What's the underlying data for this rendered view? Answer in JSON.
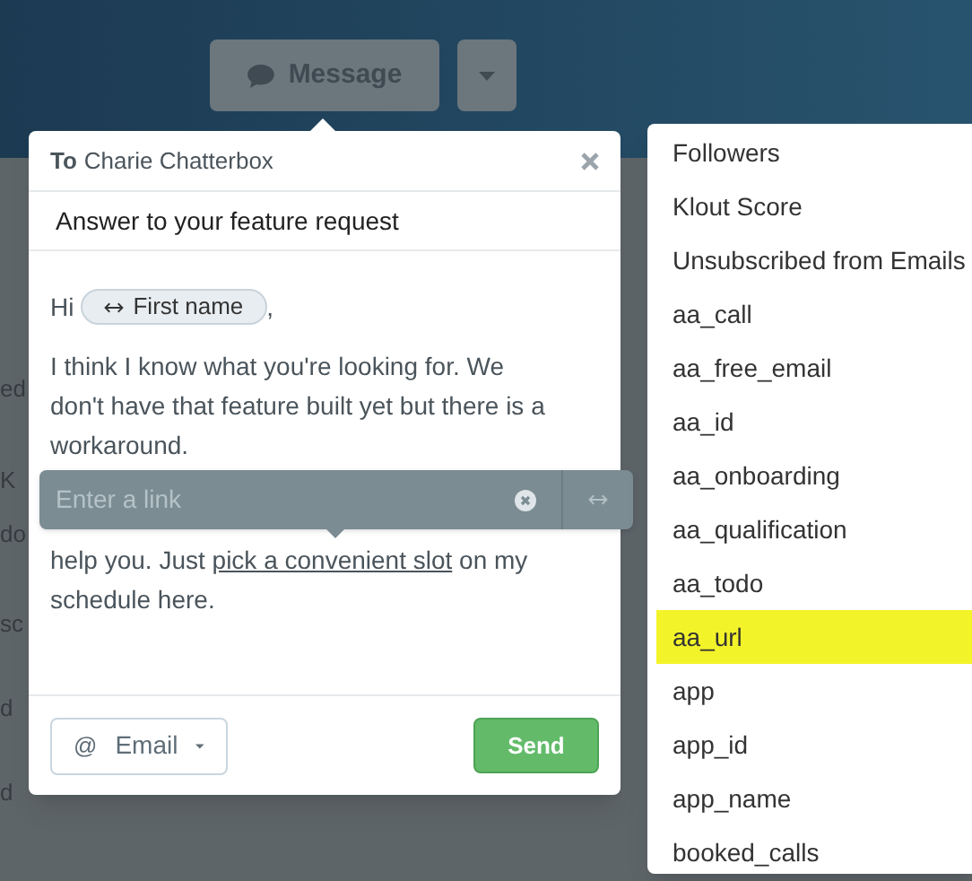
{
  "header": {
    "message_button": "Message"
  },
  "background_rows": [
    {
      "label": "ed"
    },
    {
      "label": "K"
    },
    {
      "label": "do"
    },
    {
      "label": "sc"
    },
    {
      "label": "d"
    },
    {
      "label": "d"
    }
  ],
  "composer": {
    "to_label": "To",
    "recipient": "Charie Chatterbox",
    "subject": "Answer to your feature request",
    "greeting": "Hi",
    "token": "First name",
    "greeting_end": ",",
    "paragraph_1": "I think I know what you're looking for. We don't have that feature built yet but there is a workaround.",
    "paragraph_2_before": "help you. Just",
    "paragraph_2_link": "pick a convenient slot",
    "paragraph_2_after": "on my schedule here.",
    "link_popover": {
      "placeholder": "Enter a link"
    },
    "channel_icon": "@",
    "channel_button": "Email",
    "send_button": "Send"
  },
  "attribute_menu": {
    "items": [
      {
        "label": "Followers",
        "selected": false
      },
      {
        "label": "Klout Score",
        "selected": false
      },
      {
        "label": "Unsubscribed from Emails",
        "selected": false
      },
      {
        "label": "aa_call",
        "selected": false
      },
      {
        "label": "aa_free_email",
        "selected": false
      },
      {
        "label": "aa_id",
        "selected": false
      },
      {
        "label": "aa_onboarding",
        "selected": false
      },
      {
        "label": "aa_qualification",
        "selected": false
      },
      {
        "label": "aa_todo",
        "selected": false
      },
      {
        "label": "aa_url",
        "selected": true
      },
      {
        "label": "app",
        "selected": false
      },
      {
        "label": "app_id",
        "selected": false
      },
      {
        "label": "app_name",
        "selected": false
      },
      {
        "label": "booked_calls",
        "selected": false
      }
    ]
  }
}
